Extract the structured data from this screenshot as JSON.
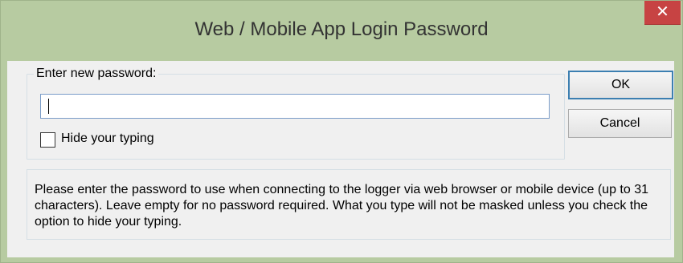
{
  "window": {
    "title": "Web / Mobile App Login Password",
    "close_glyph": "✕"
  },
  "group": {
    "label": "Enter new password:"
  },
  "password_input": {
    "value": ""
  },
  "hide_typing": {
    "label": "Hide your typing",
    "checked": false
  },
  "buttons": {
    "ok": "OK",
    "cancel": "Cancel"
  },
  "info": {
    "text": "Please enter the password to use when connecting to the logger via web browser or mobile device (up to 31 characters). Leave empty for no password required. What you type will not be masked unless you check the option to hide your typing."
  },
  "colors": {
    "frame": "#b7cba1",
    "close": "#c74343",
    "ok_border": "#3c7fb1"
  }
}
